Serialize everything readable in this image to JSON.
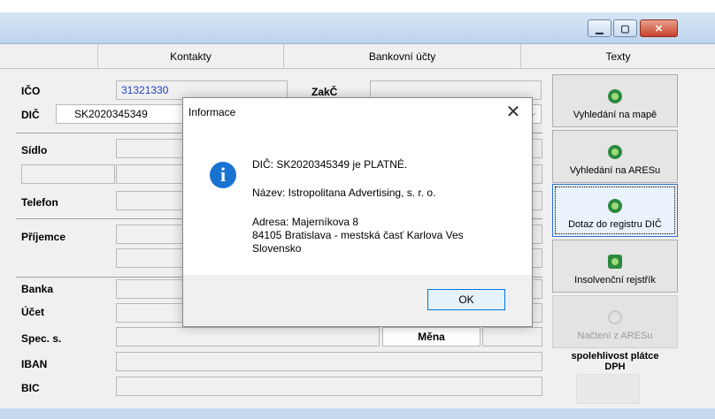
{
  "window": {
    "minimize_icon": "minimize-icon",
    "maximize_icon": "maximize-icon",
    "close_icon": "close-icon"
  },
  "tabs": [
    {
      "label": "Kontakty"
    },
    {
      "label": "Bankovní účty"
    },
    {
      "label": "Texty"
    }
  ],
  "form": {
    "ico_label": "IČO",
    "ico_value": "31321330",
    "dic_label": "DIČ",
    "dic_value": "SK2020345349",
    "zakc_label": "ZakČ",
    "sidlo_label": "Sídlo",
    "telefon_label": "Telefon",
    "prijemce_label": "Příjemce",
    "banka_label": "Banka",
    "ucet_label": "Účet",
    "spec_label": "Spec. s.",
    "mena_label": "Měna",
    "iban_label": "IBAN",
    "bic_label": "BIC"
  },
  "right_buttons": {
    "mapa": "Vyhledání na mapě",
    "ares": "Vyhledání na ARESu",
    "dic": "Dotaz do registru DIČ",
    "insolvence": "Insolvenční rejstřík",
    "nacteni": "Načtení z ARESu",
    "spolehlivost": "spolehlivost plátce DPH"
  },
  "dialog": {
    "title": "Informace",
    "close_symbol": "✕",
    "info_symbol": "i",
    "line1": "DIČ: SK2020345349 je PLATNÉ.",
    "line2": "Název: Istropolitana Advertising, s. r. o.",
    "line3": "Adresa: Majerníkova 8",
    "line4": "84105 Bratislava - mestská časť Karlova Ves",
    "line5": "Slovensko",
    "ok_label": "OK"
  }
}
